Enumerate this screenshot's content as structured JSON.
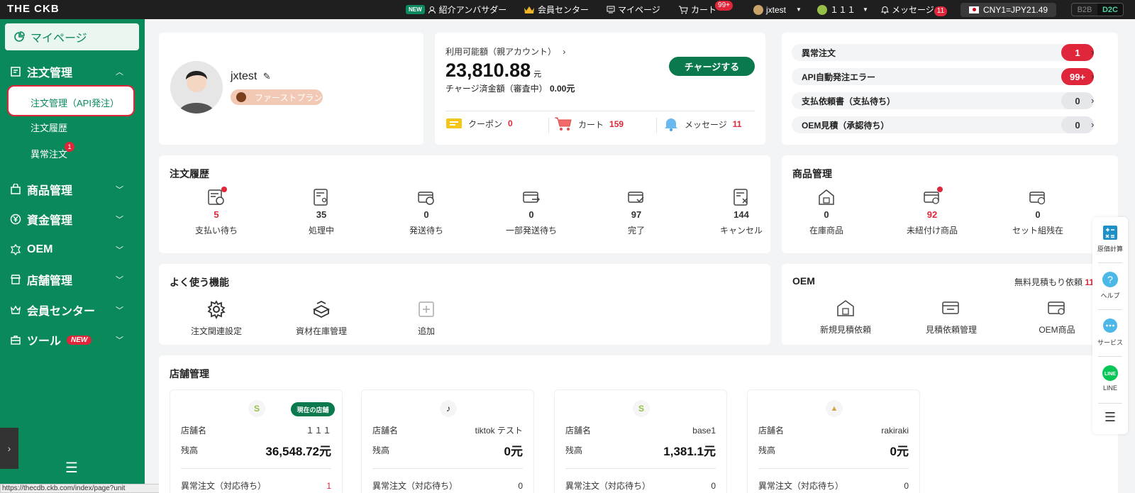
{
  "topbar": {
    "logo": "THE CKB",
    "new_chip": "NEW",
    "ambassador": "紹介アンバサダー",
    "member_center": "会員センター",
    "mypage": "マイページ",
    "cart": "カート",
    "cart_badge": "99+",
    "user": "jxtest",
    "store": "１１１",
    "message": "メッセージ",
    "message_badge": "11",
    "rate": "CNY1=JPY21.49",
    "b2b": "B2B",
    "d2c": "D2C"
  },
  "sidebar": {
    "mypage": "マイページ",
    "orders": "注文管理",
    "orders_api": "注文管理（API発注）",
    "order_history": "注文履歴",
    "abnormal": "異常注文",
    "abnormal_badge": "1",
    "products": "商品管理",
    "funds": "資金管理",
    "oem": "OEM",
    "shops": "店舗管理",
    "member": "会員センター",
    "tools": "ツール",
    "tools_tag": "NEW",
    "status_url": "https://thecdb.ckb.com/index/page?unit"
  },
  "profile": {
    "name": "jxtest",
    "plan": "ファーストプラン"
  },
  "balance": {
    "label": "利用可能額（親アカウント）",
    "amount": "23,810.88",
    "unit": "元",
    "charged_label": "チャージ済金額（審査中）",
    "charged_value": "0.00元",
    "charge_button": "チャージする",
    "coupon_label": "クーポン",
    "coupon_count": "0",
    "cart_label": "カート",
    "cart_count": "159",
    "message_label": "メッセージ",
    "message_count": "11"
  },
  "alerts": [
    {
      "label": "異常注文",
      "count": "1"
    },
    {
      "label": "API自動発注エラー",
      "count": "99+"
    },
    {
      "label": "支払依頼書（支払待ち）",
      "count": "0"
    },
    {
      "label": "OEM見積（承認待ち）",
      "count": "0"
    }
  ],
  "order_history": {
    "title": "注文履歴",
    "stats": [
      {
        "num": "5",
        "label": "支払い待ち"
      },
      {
        "num": "35",
        "label": "処理中"
      },
      {
        "num": "0",
        "label": "発送待ち"
      },
      {
        "num": "0",
        "label": "一部発送待ち"
      },
      {
        "num": "97",
        "label": "完了"
      },
      {
        "num": "144",
        "label": "キャンセル"
      }
    ]
  },
  "product_mgmt": {
    "title": "商品管理",
    "stats": [
      {
        "num": "0",
        "label": "在庫商品"
      },
      {
        "num": "92",
        "label": "未紐付け商品"
      },
      {
        "num": "0",
        "label": "セット組残在"
      }
    ]
  },
  "functions": {
    "title": "よく使う機能",
    "items": [
      "注文関連設定",
      "資材在庫管理",
      "追加"
    ]
  },
  "oem": {
    "title": "OEM",
    "free_quote": "無料見積もり依頼",
    "free_quote_count": "11",
    "items": [
      "新規見積依頼",
      "見積依頼管理",
      "OEM商品"
    ]
  },
  "shops": {
    "title": "店舗管理",
    "current_tag": "現在の店舗",
    "name_label": "店舗名",
    "balance_label": "残高",
    "abnormal_label": "異常注文（対応待ち）",
    "list": [
      {
        "name": "１１１",
        "balance": "36,548.72元",
        "abnormal": "1"
      },
      {
        "name": "tiktok テスト",
        "balance": "0元",
        "abnormal": "0"
      },
      {
        "name": "base1",
        "balance": "1,381.1元",
        "abnormal": "0"
      },
      {
        "name": "rakiraki",
        "balance": "0元",
        "abnormal": "0"
      }
    ]
  },
  "float_bar": {
    "items": [
      "原価計算",
      "ヘルプ",
      "サービス",
      "LINE"
    ],
    "line_logo": "LINE"
  }
}
